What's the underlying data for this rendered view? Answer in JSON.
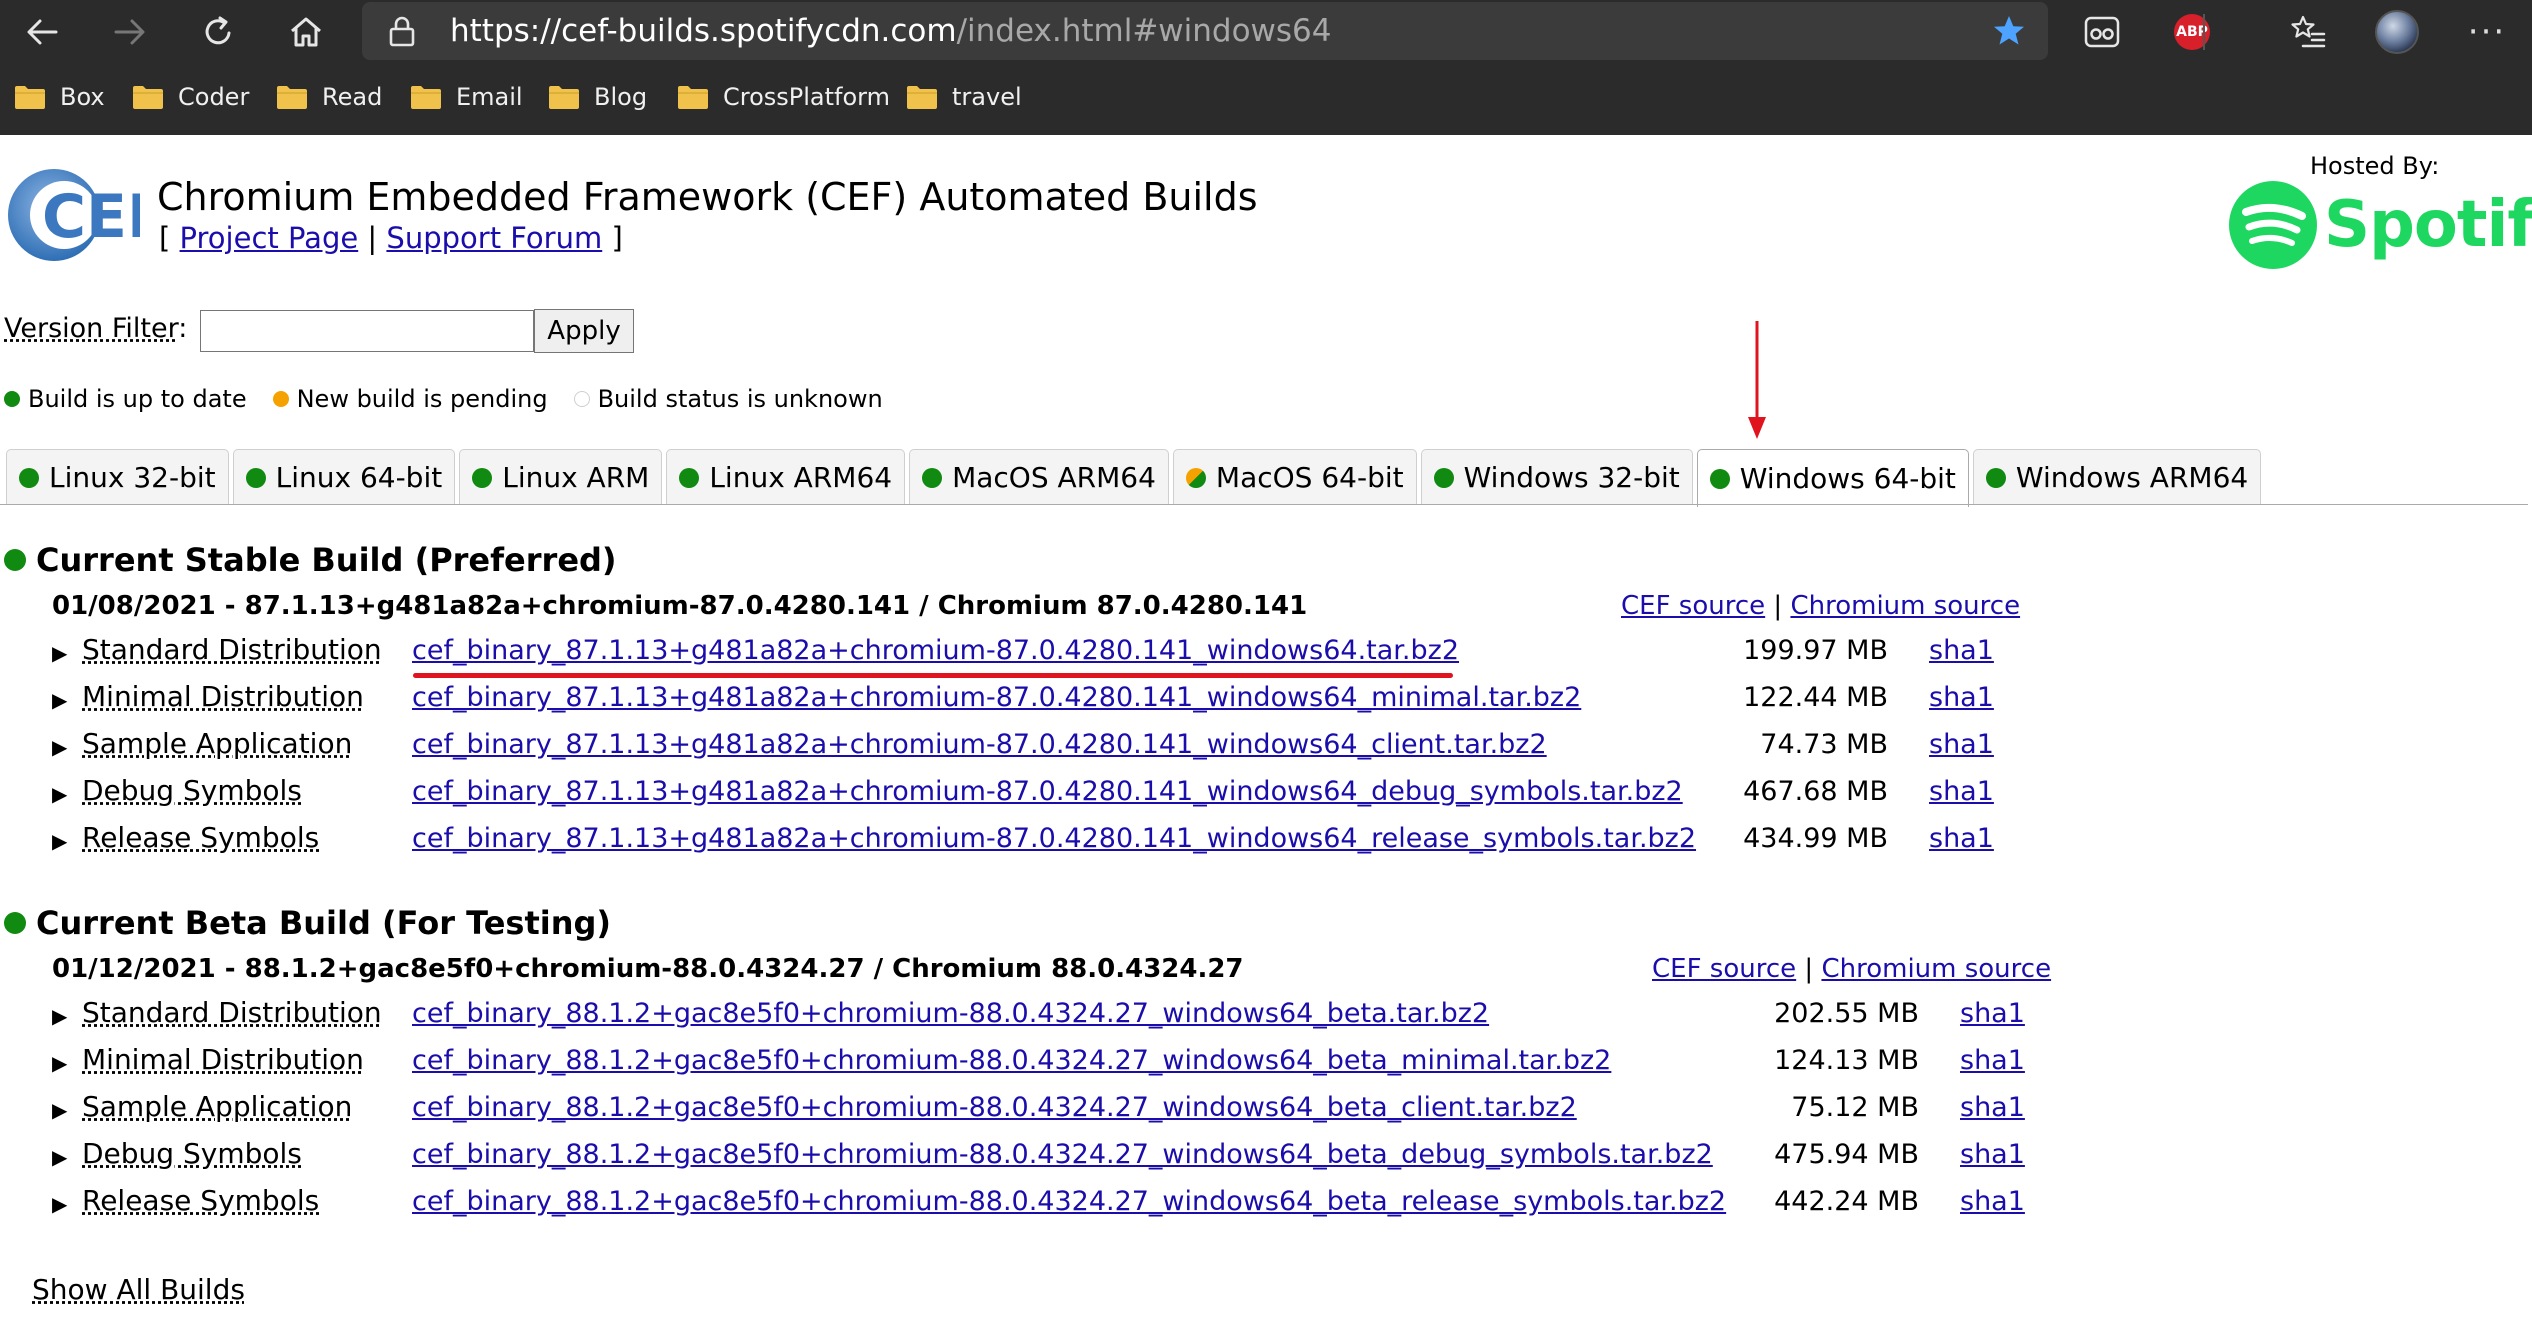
{
  "browser": {
    "url_host": "https://cef-builds.spotifycdn.com",
    "url_path": "/index.html#windows64",
    "bookmarks": [
      {
        "label": "Box"
      },
      {
        "label": "Coder"
      },
      {
        "label": "Read"
      },
      {
        "label": "Email"
      },
      {
        "label": "Blog"
      },
      {
        "label": "CrossPlatform"
      },
      {
        "label": "travel"
      }
    ],
    "abp_label": "ABP",
    "more_label": "···",
    "accent_star": "#4da3ff"
  },
  "header": {
    "title": "Chromium Embedded Framework (CEF) Automated Builds",
    "link_open": "[",
    "project_page": "Project Page",
    "sep": "|",
    "support_forum": "Support Forum",
    "link_close": "]",
    "hosted_by": "Hosted By:",
    "spotify": "Spotify",
    "logo_text": "CEF"
  },
  "filter": {
    "label": "Version Filter",
    "colon": ":",
    "value": "",
    "apply": "Apply"
  },
  "legend": [
    {
      "status": "green",
      "label": "Build is up to date"
    },
    {
      "status": "orange",
      "label": "New build is pending"
    },
    {
      "status": "unknown",
      "label": "Build status is unknown"
    }
  ],
  "tabs": [
    {
      "label": "Linux 32-bit",
      "status": "green"
    },
    {
      "label": "Linux 64-bit",
      "status": "green"
    },
    {
      "label": "Linux ARM",
      "status": "green"
    },
    {
      "label": "Linux ARM64",
      "status": "green"
    },
    {
      "label": "MacOS ARM64",
      "status": "green"
    },
    {
      "label": "MacOS 64-bit",
      "status": "mixed"
    },
    {
      "label": "Windows 32-bit",
      "status": "green"
    },
    {
      "label": "Windows 64-bit",
      "status": "green",
      "active": true
    },
    {
      "label": "Windows ARM64",
      "status": "green"
    }
  ],
  "stable": {
    "heading": "Current Stable Build (Preferred)",
    "version_line": "01/08/2021 - 87.1.13+g481a82a+chromium-87.0.4280.141 / Chromium 87.0.4280.141",
    "cef_source": "CEF source",
    "sep": "|",
    "chromium_source": "Chromium source",
    "rows": [
      {
        "dist": "Standard Distribution",
        "file": "cef_binary_87.1.13+g481a82a+chromium-87.0.4280.141_windows64.tar.bz2",
        "size": "199.97 MB",
        "sha": "sha1"
      },
      {
        "dist": "Minimal Distribution",
        "file": "cef_binary_87.1.13+g481a82a+chromium-87.0.4280.141_windows64_minimal.tar.bz2",
        "size": "122.44 MB",
        "sha": "sha1"
      },
      {
        "dist": "Sample Application",
        "file": "cef_binary_87.1.13+g481a82a+chromium-87.0.4280.141_windows64_client.tar.bz2",
        "size": "74.73 MB",
        "sha": "sha1"
      },
      {
        "dist": "Debug Symbols",
        "file": "cef_binary_87.1.13+g481a82a+chromium-87.0.4280.141_windows64_debug_symbols.tar.bz2",
        "size": "467.68 MB",
        "sha": "sha1"
      },
      {
        "dist": "Release Symbols",
        "file": "cef_binary_87.1.13+g481a82a+chromium-87.0.4280.141_windows64_release_symbols.tar.bz2",
        "size": "434.99 MB",
        "sha": "sha1"
      }
    ]
  },
  "beta": {
    "heading": "Current Beta Build (For Testing)",
    "version_line": "01/12/2021 - 88.1.2+gac8e5f0+chromium-88.0.4324.27 / Chromium 88.0.4324.27",
    "cef_source": "CEF source",
    "sep": "|",
    "chromium_source": "Chromium source",
    "rows": [
      {
        "dist": "Standard Distribution",
        "file": "cef_binary_88.1.2+gac8e5f0+chromium-88.0.4324.27_windows64_beta.tar.bz2",
        "size": "202.55 MB",
        "sha": "sha1"
      },
      {
        "dist": "Minimal Distribution",
        "file": "cef_binary_88.1.2+gac8e5f0+chromium-88.0.4324.27_windows64_beta_minimal.tar.bz2",
        "size": "124.13 MB",
        "sha": "sha1"
      },
      {
        "dist": "Sample Application",
        "file": "cef_binary_88.1.2+gac8e5f0+chromium-88.0.4324.27_windows64_beta_client.tar.bz2",
        "size": "75.12 MB",
        "sha": "sha1"
      },
      {
        "dist": "Debug Symbols",
        "file": "cef_binary_88.1.2+gac8e5f0+chromium-88.0.4324.27_windows64_beta_debug_symbols.tar.bz2",
        "size": "475.94 MB",
        "sha": "sha1"
      },
      {
        "dist": "Release Symbols",
        "file": "cef_binary_88.1.2+gac8e5f0+chromium-88.0.4324.27_windows64_beta_release_symbols.tar.bz2",
        "size": "442.24 MB",
        "sha": "sha1"
      }
    ]
  },
  "triangle": "▶",
  "show_all": "Show All Builds",
  "colors": {
    "link": "#1a0dab",
    "green": "#108a10",
    "orange": "#f5a100",
    "spotify": "#1ed760",
    "annotation_red": "#e0141e"
  }
}
